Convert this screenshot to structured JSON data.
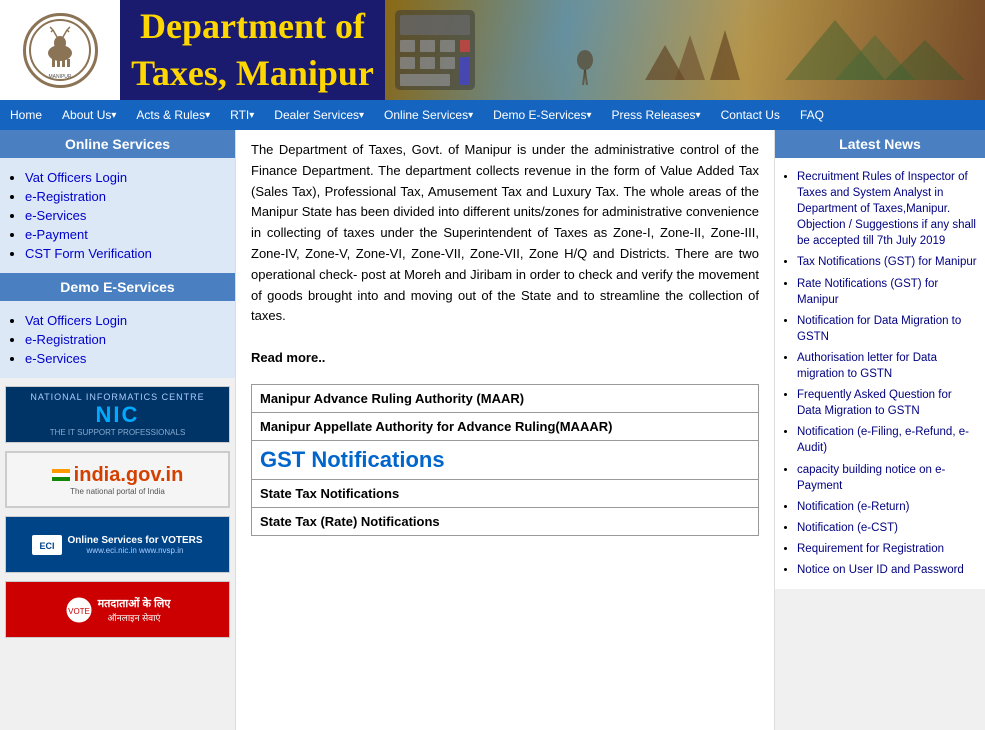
{
  "header": {
    "title": "Department of Taxes, Manipur",
    "logo_alt": "Department of Taxes Manipur Logo"
  },
  "nav": {
    "items": [
      {
        "label": "Home",
        "has_arrow": false
      },
      {
        "label": "About Us",
        "has_arrow": true
      },
      {
        "label": "Acts & Rules",
        "has_arrow": true
      },
      {
        "label": "RTI",
        "has_arrow": true
      },
      {
        "label": "Dealer Services",
        "has_arrow": true
      },
      {
        "label": "Online Services",
        "has_arrow": true
      },
      {
        "label": "Demo E-Services",
        "has_arrow": true
      },
      {
        "label": "Press Releases",
        "has_arrow": true
      },
      {
        "label": "Contact Us",
        "has_arrow": false
      },
      {
        "label": "FAQ",
        "has_arrow": false
      }
    ]
  },
  "left_sidebar": {
    "online_services": {
      "title": "Online Services",
      "links": [
        "Vat Officers Login",
        "e-Registration",
        "e-Services",
        "e-Payment",
        "CST Form Verification"
      ]
    },
    "demo_services": {
      "title": "Demo E-Services",
      "links": [
        "Vat Officers Login",
        "e-Registration",
        "e-Services"
      ]
    },
    "banners": [
      {
        "id": "nic",
        "line1": "NATIONAL",
        "line2": "INFORMATICS",
        "line3": "CENTRE",
        "logo": "NIC",
        "sub": "THE IT SUPPORT PROFESSIONALS"
      },
      {
        "id": "india",
        "url": "india.gov.in",
        "sub": "The national portal of India"
      },
      {
        "id": "voter",
        "title": "Online Services for VOTERS",
        "sub": "www.eci.nic.in   www.nvsp.in"
      },
      {
        "id": "voter-hindi",
        "title": "मतदाताओं के लिए",
        "sub": "ऑनलाइन सेवाएं"
      }
    ]
  },
  "content": {
    "description": "The Department of Taxes, Govt. of Manipur is under the administrative control of the Finance Department. The department collects revenue in the form of Value Added Tax (Sales Tax), Professional Tax, Amusement Tax and Luxury Tax. The whole areas of the Manipur State has been divided into different units/zones for administrative convenience in collecting of taxes under the Superintendent of Taxes as Zone-I, Zone-II, Zone-III, Zone-IV, Zone-V, Zone-VI, Zone-VII, Zone-VII, Zone H/Q and Districts. There are two operational check- post at Moreh and Jiribam in order to check and verify the movement of goods brought into and moving out of the State and to streamline the collection of taxes.",
    "read_more": "Read more..",
    "table_rows": [
      {
        "text": "Manipur Advance Ruling Authority (MAAR)",
        "type": "bold"
      },
      {
        "text": "Manipur Appellate Authority for Advance Ruling(MAAAR)",
        "type": "bold"
      },
      {
        "text": "GST Notifications",
        "type": "gst"
      },
      {
        "text": "State Tax Notifications",
        "type": "bold"
      },
      {
        "text": "State Tax (Rate) Notifications",
        "type": "bold"
      }
    ]
  },
  "right_sidebar": {
    "title": "Latest News",
    "items": [
      "Recruitment Rules of Inspector of Taxes and System Analyst in Department of Taxes,Manipur. Objection / Suggestions if any shall be accepted till 7th July 2019",
      "Tax Notifications (GST) for Manipur",
      "Rate Notifications (GST) for Manipur",
      "Notification for Data Migration to GSTN",
      "Authorisation letter for Data migration to GSTN",
      "Frequently Asked Question for Data Migration to GSTN",
      "Notification (e-Filing, e-Refund, e-Audit)",
      "capacity building notice on e-Payment",
      "Notification (e-Return)",
      "Notification (e-CST)",
      "Requirement for Registration",
      "Notice on User ID and Password"
    ]
  }
}
